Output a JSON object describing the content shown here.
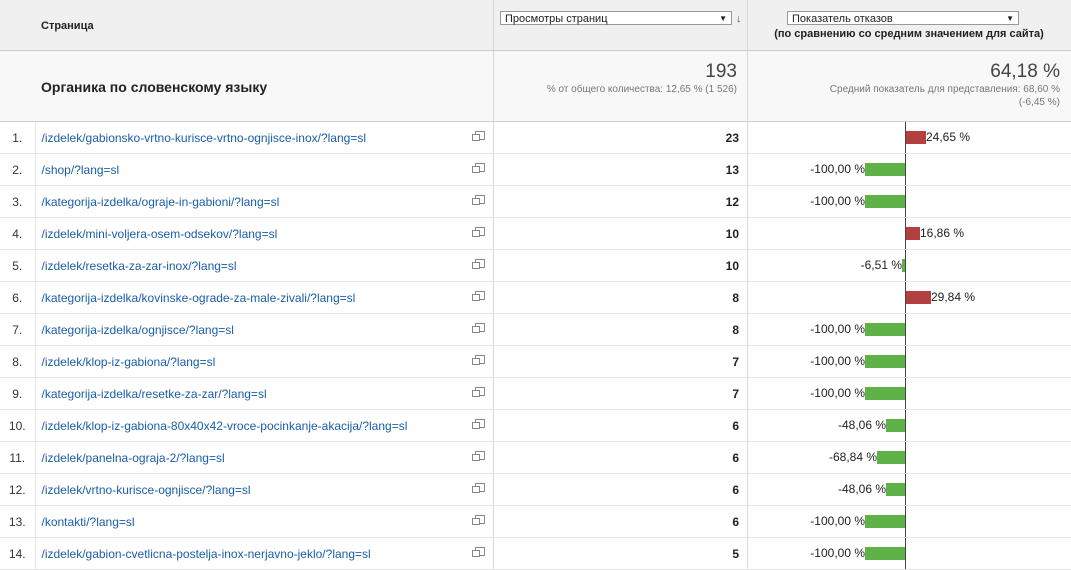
{
  "header": {
    "page_col": "Страница",
    "views_select": "Просмотры страниц",
    "bounce_select": "Показатель отказов",
    "bounce_note": "(по сравнению со средним значением для сайта)"
  },
  "summary": {
    "title": "Органика по словенскому языку",
    "views_total": "193",
    "views_share": "% от общего количества: 12,65 % (1 526)",
    "bounce_value": "64,18 %",
    "bounce_avg_line1": "Средний показатель для представления: 68,60 %",
    "bounce_avg_line2": "(-6,45 %)"
  },
  "rows": [
    {
      "n": "1.",
      "page": "/izdelek/gabionsko-vrtno-kurisce-vrtno-ognjisce-inox/?lang=sl",
      "views": "23",
      "cmp": 24.65,
      "cmp_label": "24,65 %"
    },
    {
      "n": "2.",
      "page": "/shop/?lang=sl",
      "views": "13",
      "cmp": -100,
      "cmp_label": "-100,00 %"
    },
    {
      "n": "3.",
      "page": "/kategorija-izdelka/ograje-in-gabioni/?lang=sl",
      "views": "12",
      "cmp": -100,
      "cmp_label": "-100,00 %"
    },
    {
      "n": "4.",
      "page": "/izdelek/mini-voljera-osem-odsekov/?lang=sl",
      "views": "10",
      "cmp": 16.86,
      "cmp_label": "16,86 %"
    },
    {
      "n": "5.",
      "page": "/izdelek/resetka-za-zar-inox/?lang=sl",
      "views": "10",
      "cmp": -6.51,
      "cmp_label": "-6,51 %"
    },
    {
      "n": "6.",
      "page": "/kategorija-izdelka/kovinske-ograde-za-male-zivali/?lang=sl",
      "views": "8",
      "cmp": 29.84,
      "cmp_label": "29,84 %"
    },
    {
      "n": "7.",
      "page": "/kategorija-izdelka/ognjisce/?lang=sl",
      "views": "8",
      "cmp": -100,
      "cmp_label": "-100,00 %"
    },
    {
      "n": "8.",
      "page": "/izdelek/klop-iz-gabiona/?lang=sl",
      "views": "7",
      "cmp": -100,
      "cmp_label": "-100,00 %"
    },
    {
      "n": "9.",
      "page": "/kategorija-izdelka/resetke-za-zar/?lang=sl",
      "views": "7",
      "cmp": -100,
      "cmp_label": "-100,00 %"
    },
    {
      "n": "10.",
      "page": "/izdelek/klop-iz-gabiona-80x40x42-vroce-pocinkanje-akacija/?lang=sl",
      "views": "6",
      "cmp": -48.06,
      "cmp_label": "-48,06 %"
    },
    {
      "n": "11.",
      "page": "/izdelek/panelna-ograja-2/?lang=sl",
      "views": "6",
      "cmp": -68.84,
      "cmp_label": "-68,84 %"
    },
    {
      "n": "12.",
      "page": "/izdelek/vrtno-kurisce-ognjisce/?lang=sl",
      "views": "6",
      "cmp": -48.06,
      "cmp_label": "-48,06 %"
    },
    {
      "n": "13.",
      "page": "/kontakti/?lang=sl",
      "views": "6",
      "cmp": -100,
      "cmp_label": "-100,00 %"
    },
    {
      "n": "14.",
      "page": "/izdelek/gabion-cvetlicna-postelja-inox-nerjavno-jeklo/?lang=sl",
      "views": "5",
      "cmp": -100,
      "cmp_label": "-100,00 %"
    }
  ],
  "colors": {
    "positive": "#b24041",
    "negative": "#5fb247",
    "link": "#1a5ea8"
  },
  "icons": {
    "row_action": "open-in-new-window-icon",
    "sort": "sort-descending-icon",
    "dropdown": "dropdown-arrow-icon"
  }
}
